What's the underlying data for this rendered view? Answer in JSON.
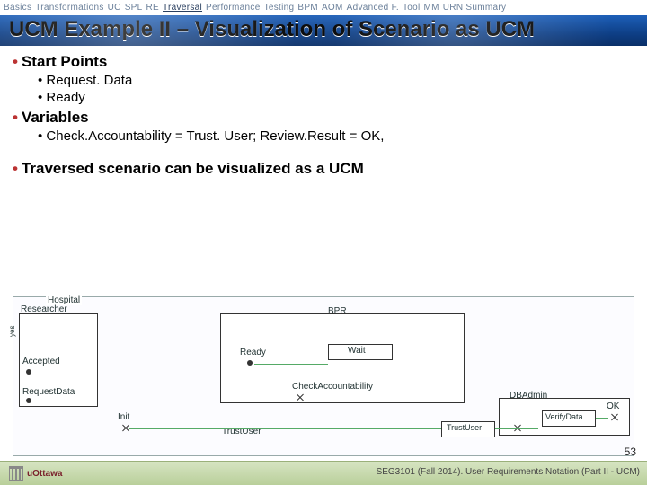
{
  "nav": {
    "items": [
      "Basics",
      "Transformations",
      "UC",
      "SPL",
      "RE",
      "Traversal",
      "Performance",
      "Testing",
      "BPM",
      "AOM",
      "Advanced F.",
      "Tool",
      "MM",
      "URN Summary"
    ],
    "activeIndex": 5
  },
  "title": "UCM Example II – Visualization of Scenario as UCM",
  "bullets": {
    "sp": "Start Points",
    "sp_items": [
      "Request. Data",
      "Ready"
    ],
    "vars": "Variables",
    "vars_items": [
      "Check.Accountability = Trust. User; Review.Result = OK,"
    ],
    "trav": "Traversed scenario can be visualized as a UCM"
  },
  "diagram": {
    "outer": "Hospital",
    "researcher": "Researcher",
    "accepted": "Accepted",
    "requestdata": "RequestData",
    "init": "Init",
    "bpr": "BPR",
    "ready": "Ready",
    "wait": "Wait",
    "checkacc": "CheckAccountability",
    "dbadmin": "DBAdmin",
    "trustuser": "TrustUser",
    "verify": "VerifyData",
    "ok": "OK"
  },
  "footer": {
    "uo": "uOttawa",
    "course": "SEG3101 (Fall 2014).  User Requirements Notation (Part II - UCM)"
  },
  "page": "53"
}
